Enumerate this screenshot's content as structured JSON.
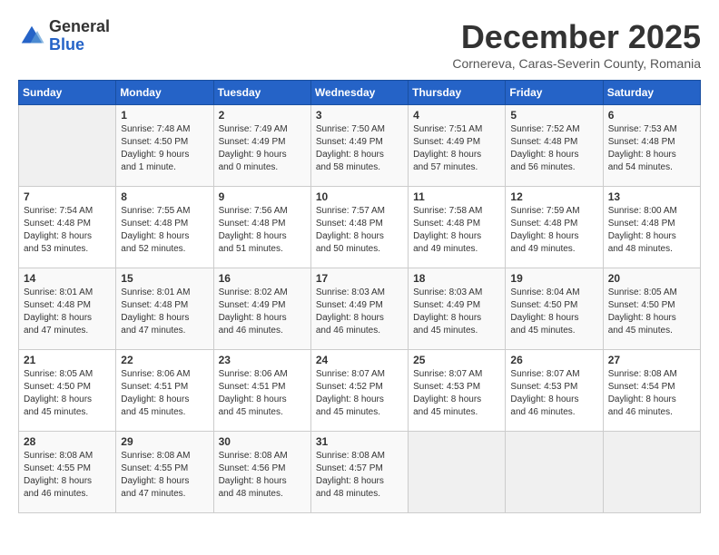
{
  "logo": {
    "line1": "General",
    "line2": "Blue"
  },
  "title": "December 2025",
  "subtitle": "Cornereva, Caras-Severin County, Romania",
  "weekdays": [
    "Sunday",
    "Monday",
    "Tuesday",
    "Wednesday",
    "Thursday",
    "Friday",
    "Saturday"
  ],
  "weeks": [
    [
      {
        "day": "",
        "info": ""
      },
      {
        "day": "1",
        "info": "Sunrise: 7:48 AM\nSunset: 4:50 PM\nDaylight: 9 hours\nand 1 minute."
      },
      {
        "day": "2",
        "info": "Sunrise: 7:49 AM\nSunset: 4:49 PM\nDaylight: 9 hours\nand 0 minutes."
      },
      {
        "day": "3",
        "info": "Sunrise: 7:50 AM\nSunset: 4:49 PM\nDaylight: 8 hours\nand 58 minutes."
      },
      {
        "day": "4",
        "info": "Sunrise: 7:51 AM\nSunset: 4:49 PM\nDaylight: 8 hours\nand 57 minutes."
      },
      {
        "day": "5",
        "info": "Sunrise: 7:52 AM\nSunset: 4:48 PM\nDaylight: 8 hours\nand 56 minutes."
      },
      {
        "day": "6",
        "info": "Sunrise: 7:53 AM\nSunset: 4:48 PM\nDaylight: 8 hours\nand 54 minutes."
      }
    ],
    [
      {
        "day": "7",
        "info": "Sunrise: 7:54 AM\nSunset: 4:48 PM\nDaylight: 8 hours\nand 53 minutes."
      },
      {
        "day": "8",
        "info": "Sunrise: 7:55 AM\nSunset: 4:48 PM\nDaylight: 8 hours\nand 52 minutes."
      },
      {
        "day": "9",
        "info": "Sunrise: 7:56 AM\nSunset: 4:48 PM\nDaylight: 8 hours\nand 51 minutes."
      },
      {
        "day": "10",
        "info": "Sunrise: 7:57 AM\nSunset: 4:48 PM\nDaylight: 8 hours\nand 50 minutes."
      },
      {
        "day": "11",
        "info": "Sunrise: 7:58 AM\nSunset: 4:48 PM\nDaylight: 8 hours\nand 49 minutes."
      },
      {
        "day": "12",
        "info": "Sunrise: 7:59 AM\nSunset: 4:48 PM\nDaylight: 8 hours\nand 49 minutes."
      },
      {
        "day": "13",
        "info": "Sunrise: 8:00 AM\nSunset: 4:48 PM\nDaylight: 8 hours\nand 48 minutes."
      }
    ],
    [
      {
        "day": "14",
        "info": "Sunrise: 8:01 AM\nSunset: 4:48 PM\nDaylight: 8 hours\nand 47 minutes."
      },
      {
        "day": "15",
        "info": "Sunrise: 8:01 AM\nSunset: 4:48 PM\nDaylight: 8 hours\nand 47 minutes."
      },
      {
        "day": "16",
        "info": "Sunrise: 8:02 AM\nSunset: 4:49 PM\nDaylight: 8 hours\nand 46 minutes."
      },
      {
        "day": "17",
        "info": "Sunrise: 8:03 AM\nSunset: 4:49 PM\nDaylight: 8 hours\nand 46 minutes."
      },
      {
        "day": "18",
        "info": "Sunrise: 8:03 AM\nSunset: 4:49 PM\nDaylight: 8 hours\nand 45 minutes."
      },
      {
        "day": "19",
        "info": "Sunrise: 8:04 AM\nSunset: 4:50 PM\nDaylight: 8 hours\nand 45 minutes."
      },
      {
        "day": "20",
        "info": "Sunrise: 8:05 AM\nSunset: 4:50 PM\nDaylight: 8 hours\nand 45 minutes."
      }
    ],
    [
      {
        "day": "21",
        "info": "Sunrise: 8:05 AM\nSunset: 4:50 PM\nDaylight: 8 hours\nand 45 minutes."
      },
      {
        "day": "22",
        "info": "Sunrise: 8:06 AM\nSunset: 4:51 PM\nDaylight: 8 hours\nand 45 minutes."
      },
      {
        "day": "23",
        "info": "Sunrise: 8:06 AM\nSunset: 4:51 PM\nDaylight: 8 hours\nand 45 minutes."
      },
      {
        "day": "24",
        "info": "Sunrise: 8:07 AM\nSunset: 4:52 PM\nDaylight: 8 hours\nand 45 minutes."
      },
      {
        "day": "25",
        "info": "Sunrise: 8:07 AM\nSunset: 4:53 PM\nDaylight: 8 hours\nand 45 minutes."
      },
      {
        "day": "26",
        "info": "Sunrise: 8:07 AM\nSunset: 4:53 PM\nDaylight: 8 hours\nand 46 minutes."
      },
      {
        "day": "27",
        "info": "Sunrise: 8:08 AM\nSunset: 4:54 PM\nDaylight: 8 hours\nand 46 minutes."
      }
    ],
    [
      {
        "day": "28",
        "info": "Sunrise: 8:08 AM\nSunset: 4:55 PM\nDaylight: 8 hours\nand 46 minutes."
      },
      {
        "day": "29",
        "info": "Sunrise: 8:08 AM\nSunset: 4:55 PM\nDaylight: 8 hours\nand 47 minutes."
      },
      {
        "day": "30",
        "info": "Sunrise: 8:08 AM\nSunset: 4:56 PM\nDaylight: 8 hours\nand 48 minutes."
      },
      {
        "day": "31",
        "info": "Sunrise: 8:08 AM\nSunset: 4:57 PM\nDaylight: 8 hours\nand 48 minutes."
      },
      {
        "day": "",
        "info": ""
      },
      {
        "day": "",
        "info": ""
      },
      {
        "day": "",
        "info": ""
      }
    ]
  ]
}
